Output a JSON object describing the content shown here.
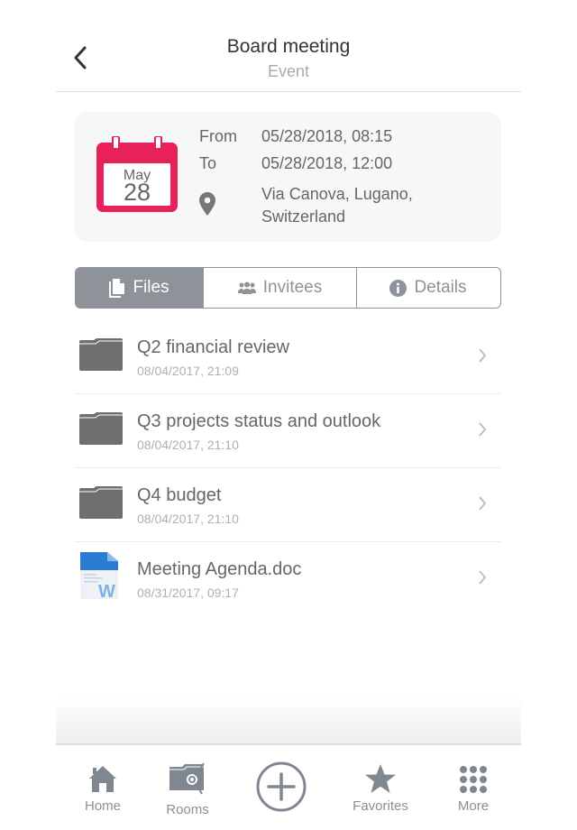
{
  "header": {
    "title": "Board meeting",
    "subtitle": "Event"
  },
  "event": {
    "calendar_month": "May",
    "calendar_day": "28",
    "from_label": "From",
    "from_value": "05/28/2018, 08:15",
    "to_label": "To",
    "to_value": "05/28/2018, 12:00",
    "location_line1": "Via Canova, Lugano,",
    "location_line2": "Switzerland",
    "accent_color": "#e8215a"
  },
  "tabs": [
    {
      "label": "Files",
      "icon": "files-icon",
      "active": true
    },
    {
      "label": "Invitees",
      "icon": "people-icon",
      "active": false
    },
    {
      "label": "Details",
      "icon": "info-icon",
      "active": false
    }
  ],
  "files": [
    {
      "name": "Q2 financial review",
      "date": "08/04/2017, 21:09",
      "type": "folder"
    },
    {
      "name": "Q3 projects status and outlook",
      "date": "08/04/2017, 21:10",
      "type": "folder"
    },
    {
      "name": "Q4 budget",
      "date": "08/04/2017, 21:10",
      "type": "folder"
    },
    {
      "name": "Meeting Agenda.doc",
      "date": "08/31/2017, 09:17",
      "type": "word-document"
    }
  ],
  "tabbar": {
    "home": "Home",
    "rooms": "Rooms",
    "favorites": "Favorites",
    "more": "More"
  }
}
